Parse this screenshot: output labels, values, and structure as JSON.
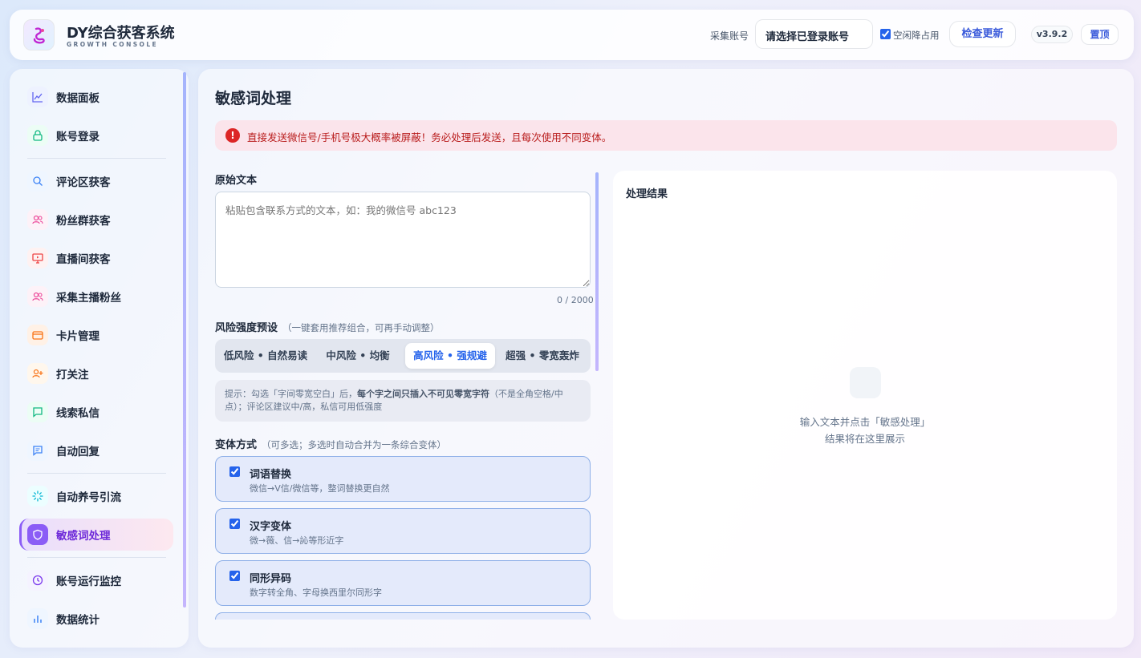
{
  "header": {
    "title": "DY综合获客系统",
    "subtitle": "GROWTH CONSOLE",
    "account_label": "采集账号",
    "account_select": "请选择已登录账号",
    "idle_label": "空闲降占用",
    "update_button": "检查更新",
    "version": "v3.9.2",
    "top_button": "置顶"
  },
  "sidebar": {
    "items": [
      {
        "label": "数据面板",
        "icon": "chart-line-icon",
        "color": "#eef2ff"
      },
      {
        "label": "账号登录",
        "icon": "lock-icon",
        "color": "#ecfdf5"
      },
      {
        "label": "评论区获客",
        "icon": "search-icon",
        "color": "#eff6ff"
      },
      {
        "label": "粉丝群获客",
        "icon": "users-icon",
        "color": "#fdf2f8"
      },
      {
        "label": "直播间获客",
        "icon": "monitor-icon",
        "color": "#fef2f2"
      },
      {
        "label": "采集主播粉丝",
        "icon": "users-icon",
        "color": "#fdf2f8"
      },
      {
        "label": "卡片管理",
        "icon": "card-icon",
        "color": "#fff1e6"
      },
      {
        "label": "打关注",
        "icon": "user-plus-icon",
        "color": "#fff7ed"
      },
      {
        "label": "线索私信",
        "icon": "message-icon",
        "color": "#ecfdf5"
      },
      {
        "label": "自动回复",
        "icon": "reply-icon",
        "color": "#eff6ff"
      },
      {
        "label": "自动养号引流",
        "icon": "spinner-icon",
        "color": "#ecfeff"
      },
      {
        "label": "敏感词处理",
        "icon": "shield-icon",
        "color": "#8b5cf6"
      },
      {
        "label": "账号运行监控",
        "icon": "clock-icon",
        "color": "#f5f3ff"
      },
      {
        "label": "数据统计",
        "icon": "bar-chart-icon",
        "color": "#eff6ff"
      }
    ]
  },
  "main": {
    "title": "敏感词处理",
    "alert": "直接发送微信号/手机号极大概率被屏蔽！务必处理后发送，且每次使用不同变体。",
    "original_label": "原始文本",
    "placeholder": "粘贴包含联系方式的文本，如：我的微信号 abc123",
    "counter": "0 / 2000",
    "preset_label": "风险强度预设",
    "preset_hint": "（一键套用推荐组合，可再手动调整）",
    "presets": [
      "低风险 • 自然易读",
      "中风险 • 均衡",
      "高风险 • 强规避",
      "超强 • 零宽轰炸"
    ],
    "tip_prefix": "提示：勾选「字间零宽空白」后，",
    "tip_bold": "每个字之间只插入不可见零宽字符",
    "tip_suffix": "（不是全角空格/中点）；评论区建议中/高，私信可用低强度",
    "variant_label": "变体方式",
    "variant_hint": "（可多选；多选时自动合并为一条综合变体）",
    "options": [
      {
        "title": "词语替换",
        "desc": "微信→V信/微信等，整词替换更自然"
      },
      {
        "title": "汉字变体",
        "desc": "微→薇、信→訫等形近字"
      },
      {
        "title": "同形异码",
        "desc": "数字转全角、字母换西里尔同形字"
      }
    ]
  },
  "result": {
    "title": "处理结果",
    "empty_line1": "输入文本并点击「敏感处理」",
    "empty_line2": "结果将在这里展示"
  }
}
